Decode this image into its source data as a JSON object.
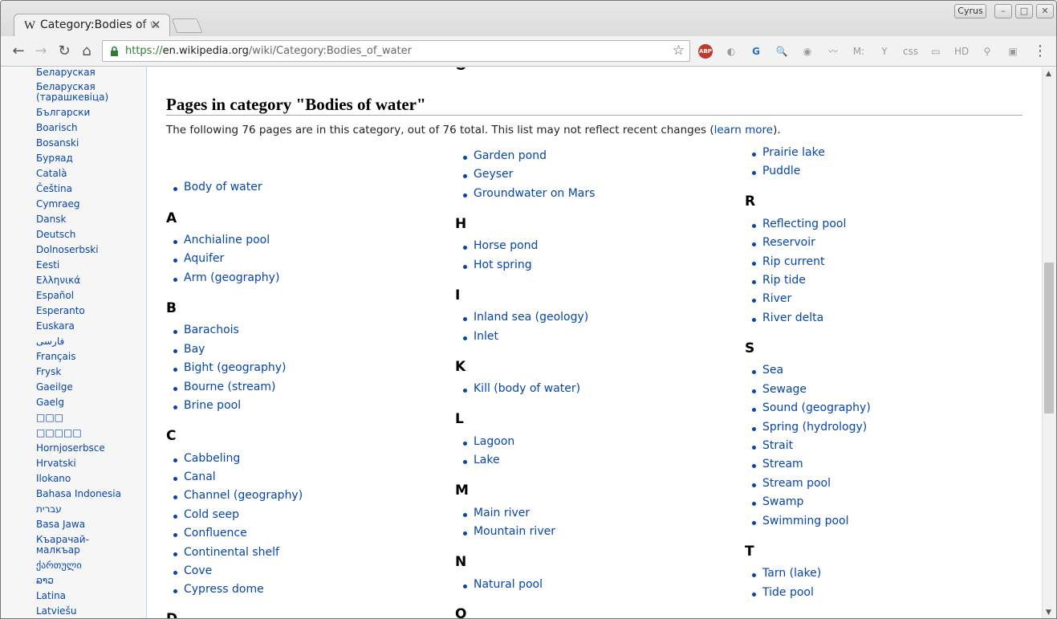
{
  "browser": {
    "tab_title": "Category:Bodies of water",
    "tab_favicon": "W",
    "tab_close": "✕",
    "user_label": "Cyrus",
    "url_scheme": "https://",
    "url_domain": "en.wikipedia.org",
    "url_path": "/wiki/Category:Bodies_of_water",
    "extensions": [
      "abp-icon",
      "shield-icon",
      "translate-icon",
      "search-ext-icon",
      "color-wheel-icon",
      "feather-icon",
      "m-icon",
      "y-icon",
      "css-icon",
      "folder-icon",
      "hd-icon",
      "pin-icon",
      "mask-icon"
    ]
  },
  "sidebar": {
    "languages": [
      "Беларуская",
      "Беларуская (тарашкевіца)",
      "Български",
      "Boarisch",
      "Bosanski",
      "Буряад",
      "Català",
      "Čeština",
      "Cymraeg",
      "Dansk",
      "Deutsch",
      "Dolnoserbski",
      "Eesti",
      "Ελληνικά",
      "Español",
      "Esperanto",
      "Euskara",
      "فارسی",
      "Français",
      "Frysk",
      "Gaeilge",
      "Gaelg",
      "□□□",
      "□□□□□",
      "Hornjoserbsce",
      "Hrvatski",
      "Ilokano",
      "Bahasa Indonesia",
      "עברית",
      "Basa Jawa",
      "Къарачай-малкъар",
      "ქართული",
      "ລາວ",
      "Latina",
      "Latviešu"
    ]
  },
  "content": {
    "partial_top": "O",
    "heading": "Pages in category \"Bodies of water\"",
    "intro_text": "The following 76 pages are in this category, out of 76 total. This list may not reflect recent changes (",
    "intro_link": "learn more",
    "intro_end": ").",
    "col1": {
      "pre": [
        "Body of water"
      ],
      "A": [
        "Anchialine pool",
        "Aquifer",
        "Arm (geography)"
      ],
      "B": [
        "Barachois",
        "Bay",
        "Bight (geography)",
        "Bourne (stream)",
        "Brine pool"
      ],
      "C": [
        "Cabbeling",
        "Canal",
        "Channel (geography)",
        "Cold seep",
        "Confluence",
        "Continental shelf",
        "Cove",
        "Cypress dome"
      ],
      "partial": "D"
    },
    "col2": {
      "G": [
        "Garden pond",
        "Geyser",
        "Groundwater on Mars"
      ],
      "H": [
        "Horse pond",
        "Hot spring"
      ],
      "I": [
        "Inland sea (geology)",
        "Inlet"
      ],
      "K": [
        "Kill (body of water)"
      ],
      "L": [
        "Lagoon",
        "Lake"
      ],
      "M": [
        "Main river",
        "Mountain river"
      ],
      "N": [
        "Natural pool"
      ],
      "partial": "O"
    },
    "col3": {
      "P": [
        "Prairie lake",
        "Puddle"
      ],
      "R": [
        "Reflecting pool",
        "Reservoir",
        "Rip current",
        "Rip tide",
        "River",
        "River delta"
      ],
      "S": [
        "Sea",
        "Sewage",
        "Sound (geography)",
        "Spring (hydrology)",
        "Strait",
        "Stream",
        "Stream pool",
        "Swamp",
        "Swimming pool"
      ],
      "T": [
        "Tarn (lake)",
        "Tide pool"
      ]
    },
    "letters": {
      "A": "A",
      "B": "B",
      "C": "C",
      "H": "H",
      "I": "I",
      "K": "K",
      "L": "L",
      "M": "M",
      "N": "N",
      "R": "R",
      "S": "S",
      "T": "T"
    }
  }
}
